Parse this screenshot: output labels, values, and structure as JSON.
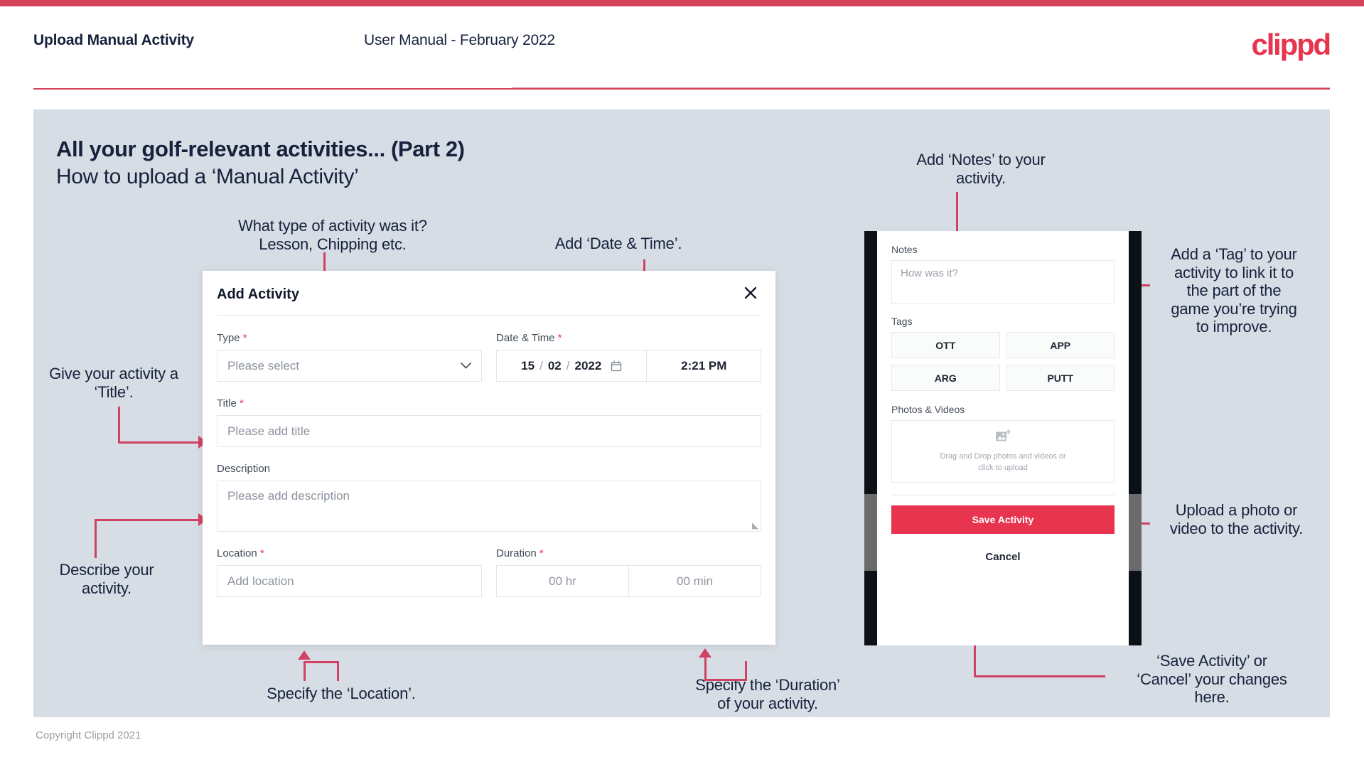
{
  "header": {
    "title": "Upload Manual Activity",
    "subtitle": "User Manual - February 2022",
    "brand": "clippd"
  },
  "slide": {
    "title": "All your golf-relevant activities... (Part 2)",
    "subtitle": "How to upload a ‘Manual Activity’",
    "footer": "Copyright Clippd 2021"
  },
  "callouts": {
    "type": "What type of activity was it?\nLesson, Chipping etc.",
    "datetime": "Add ‘Date & Time’.",
    "title": "Give your activity a\n‘Title’.",
    "description": "Describe your\nactivity.",
    "location": "Specify the ‘Location’.",
    "duration": "Specify the ‘Duration’\nof your activity.",
    "notes": "Add ‘Notes’ to your\nactivity.",
    "tags": "Add a ‘Tag’ to your\nactivity to link it to\nthe part of the\ngame you’re trying\nto improve.",
    "photos": "Upload a photo or\nvideo to the activity.",
    "save": "‘Save Activity’ or\n‘Cancel’ your changes\nhere."
  },
  "modal": {
    "title": "Add Activity",
    "close_icon": "close-icon",
    "fields": {
      "type": {
        "label": "Type",
        "required": "*",
        "placeholder": "Please select",
        "chevron": "⌄"
      },
      "datetime": {
        "label": "Date & Time",
        "required": "*",
        "day": "15",
        "sep1": "/",
        "month": "02",
        "sep2": "/",
        "year": "2022",
        "time": "2:21 PM"
      },
      "title": {
        "label": "Title",
        "required": "*",
        "placeholder": "Please add title"
      },
      "description": {
        "label": "Description",
        "required": "",
        "placeholder": "Please add description"
      },
      "location": {
        "label": "Location",
        "required": "*",
        "placeholder": "Add location"
      },
      "duration": {
        "label": "Duration",
        "required": "*",
        "hours_placeholder": "00 hr",
        "minutes_placeholder": "00 min"
      }
    }
  },
  "phone": {
    "notes_label": "Notes",
    "notes_placeholder": "How was it?",
    "tags_label": "Tags",
    "tags": [
      "OTT",
      "APP",
      "ARG",
      "PUTT"
    ],
    "photos_label": "Photos & Videos",
    "dropzone_line1": "Drag and Drop photos and videos or",
    "dropzone_line2": "click to upload",
    "save_label": "Save Activity",
    "cancel_label": "Cancel"
  },
  "colors": {
    "brand_red": "#e8344e",
    "top_bar": "#d34359",
    "arrow": "#cf4264",
    "slide_bg": "#d7dde4",
    "text_dark": "#16213c"
  }
}
